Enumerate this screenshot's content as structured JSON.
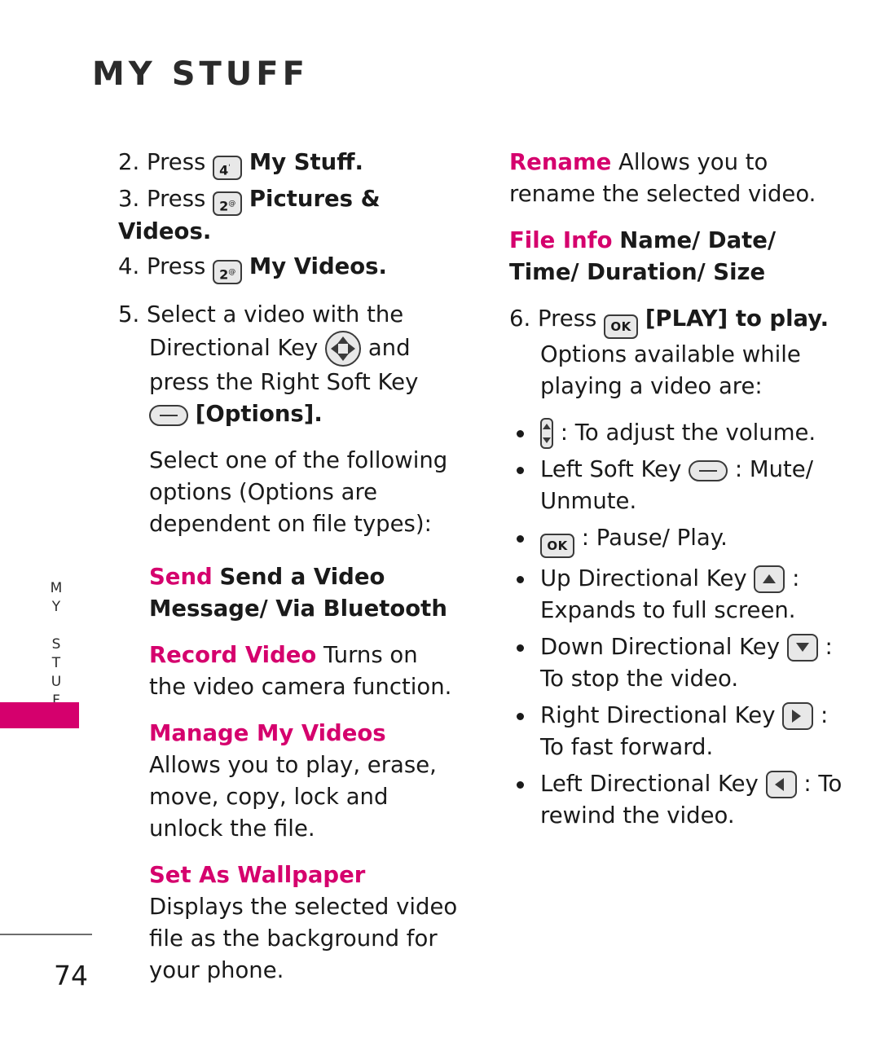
{
  "header": {
    "title": "MY STUFF"
  },
  "side_tab": {
    "label": "MY STUFF"
  },
  "footer": {
    "page_number": "74"
  },
  "keys": {
    "four": "4",
    "four_sup": "'",
    "two": "2",
    "two_sup": "@",
    "ok": "OK"
  },
  "left_column": {
    "steps": [
      {
        "num": "2. Press",
        "key": "key-4",
        "after": "My Stuff."
      },
      {
        "num": "3. Press",
        "key": "key-2",
        "after": "Pictures & Videos."
      },
      {
        "num": "4. Press",
        "key": "key-2",
        "after": "My Videos."
      }
    ],
    "step5": {
      "line1": "5. Select a video with the",
      "line2a": "Directional Key",
      "line2b": "and",
      "line3": "press the Right Soft Key",
      "line4": "[Options]."
    },
    "intro": {
      "line1": "Select one of the following",
      "line2": "options (Options are",
      "line3": "dependent on file types):"
    },
    "options": [
      {
        "label": "Send",
        "body_bold": "Send a Video Message/ Via Bluetooth",
        "body": ""
      },
      {
        "label": "Record Video",
        "body_bold": "",
        "body": "Turns on the video camera function."
      },
      {
        "label": "Manage My Videos",
        "body_bold": "",
        "body": "Allows you to play, erase, move, copy, lock and unlock the file."
      },
      {
        "label": "Set As Wallpaper",
        "body_bold": "",
        "body": "Displays the selected video file as the background for your phone."
      }
    ]
  },
  "right_column": {
    "options": [
      {
        "label": "Rename",
        "body": "Allows you to rename the selected video."
      },
      {
        "label": "File Info",
        "body_bold": "Name/ Date/ Time/ Duration/ Size"
      }
    ],
    "step6": {
      "pre": "6. Press",
      "post": "[PLAY] to play.",
      "line2": "Options available while",
      "line3": "playing a video are:"
    },
    "bullets": [
      {
        "icon": "volume-key",
        "text": ": To adjust the volume."
      },
      {
        "icon": "left-soft-key",
        "pre": "Left Soft Key",
        "text": ": Mute/ Unmute."
      },
      {
        "icon": "ok-key",
        "text": ": Pause/ Play."
      },
      {
        "icon": "up-directional-key",
        "pre": "Up Directional Key",
        "text": ": Expands to full screen."
      },
      {
        "icon": "down-directional-key",
        "pre": "Down Directional Key",
        "text": ": To stop the video."
      },
      {
        "icon": "right-directional-key",
        "pre": "Right Directional Key",
        "text": ": To fast forward."
      },
      {
        "icon": "left-directional-key",
        "pre": "Left Directional Key",
        "text": ": To rewind the video."
      }
    ]
  },
  "colors": {
    "accent": "#d5006d",
    "text": "#1a1a1a"
  }
}
